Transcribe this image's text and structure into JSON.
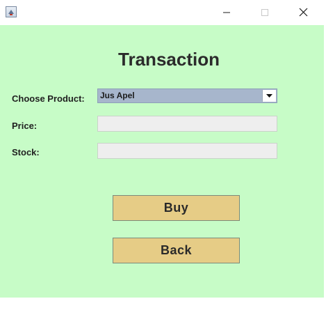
{
  "window": {
    "icon": "java-app-icon",
    "controls": {
      "minimize": "minimize-icon",
      "maximize": "maximize-icon",
      "close": "close-icon"
    }
  },
  "form": {
    "title": "Transaction",
    "product_label": "Choose Product:",
    "product_selected": "Jus Apel",
    "price_label": "Price:",
    "price_value": "",
    "stock_label": "Stock:",
    "stock_value": ""
  },
  "buttons": {
    "buy_label": "Buy",
    "back_label": "Back"
  },
  "colors": {
    "panel_background": "#c7fcc7",
    "button_fill": "#e6cc86",
    "combo_fill": "#a7b6cc",
    "field_fill": "#eeeeee"
  }
}
